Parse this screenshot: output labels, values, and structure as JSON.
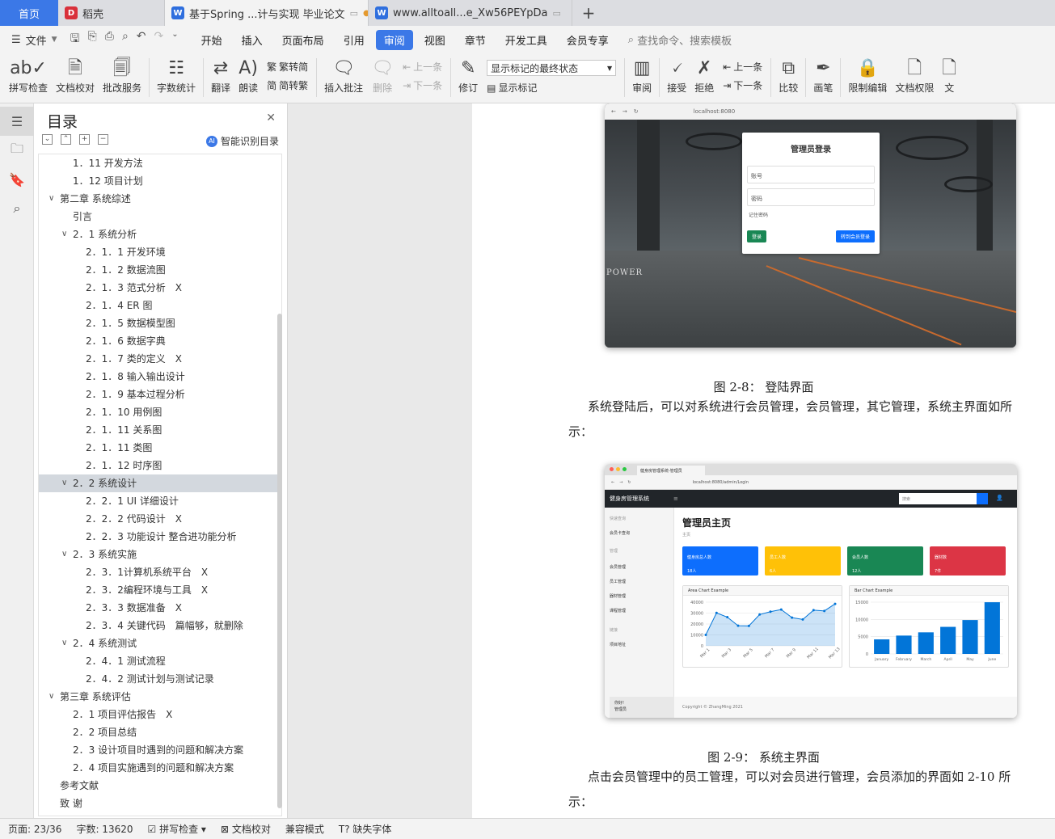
{
  "tabs": {
    "home": "首页",
    "items": [
      {
        "title": "稻壳",
        "icon_color": "#d9303a",
        "icon_glyph": "D"
      },
      {
        "title": "基于Spring ...计与实现 毕业论文",
        "icon_color": "#2f6fde",
        "icon_glyph": "W",
        "unsaved": true,
        "active": true
      },
      {
        "title": "www.alltoall...e_Xw56PEYpDa",
        "icon_color": "#2f6fde",
        "icon_glyph": "W"
      }
    ]
  },
  "menu": {
    "file": "文件",
    "items": [
      "开始",
      "插入",
      "页面布局",
      "引用",
      "审阅",
      "视图",
      "章节",
      "开发工具",
      "会员专享"
    ],
    "active": "审阅",
    "search": "查找命令、搜索模板"
  },
  "ribbon": {
    "spell_check": "拼写检查",
    "doc_proof": "文档校对",
    "annotate_service": "批改服务",
    "word_count": "字数统计",
    "translate": "翻译",
    "read_aloud": "朗读",
    "trad_to_simp": "繁转简",
    "simp_to_trad": "简转繁",
    "insert_comment": "插入批注",
    "delete": "删除",
    "prev_comment": "上一条",
    "next_comment": "下一条",
    "track_changes": "修订",
    "markup_state": "显示标记的最终状态",
    "show_markup": "显示标记",
    "review": "审阅",
    "accept": "接受",
    "reject": "拒绝",
    "prev_change": "上一条",
    "next_change": "下一条",
    "compare": "比较",
    "pen": "画笔",
    "restrict_edit": "限制编辑",
    "doc_permission": "文档权限",
    "doc_cut": "文"
  },
  "toc": {
    "title": "目录",
    "smart": "智能识别目录",
    "items": [
      {
        "text": "1．11 开发方法",
        "level": 3,
        "caret": ""
      },
      {
        "text": "1．12 项目计划",
        "level": 3,
        "caret": ""
      },
      {
        "text": "第二章 系统综述",
        "level": 1,
        "caret": "v"
      },
      {
        "text": "引言",
        "level": 3,
        "caret": ""
      },
      {
        "text": "2．1 系统分析",
        "level": 2,
        "caret": "v"
      },
      {
        "text": "2．1．1 开发环境",
        "level": 4,
        "caret": ""
      },
      {
        "text": "2．1．2 数据流图",
        "level": 4,
        "caret": ""
      },
      {
        "text": "2．1．3 范式分析　X",
        "level": 4,
        "caret": ""
      },
      {
        "text": "2．1．4 ER 图",
        "level": 4,
        "caret": ""
      },
      {
        "text": "2．1．5 数据模型图",
        "level": 4,
        "caret": ""
      },
      {
        "text": "2．1．6 数据字典",
        "level": 4,
        "caret": ""
      },
      {
        "text": "2．1．7 类的定义　X",
        "level": 4,
        "caret": ""
      },
      {
        "text": "2．1．8 输入输出设计",
        "level": 4,
        "caret": ""
      },
      {
        "text": "2．1．9 基本过程分析",
        "level": 4,
        "caret": ""
      },
      {
        "text": "2．1．10 用例图",
        "level": 4,
        "caret": ""
      },
      {
        "text": "2．1．11 关系图",
        "level": 4,
        "caret": ""
      },
      {
        "text": "2．1．11 类图",
        "level": 4,
        "caret": ""
      },
      {
        "text": "2．1．12 时序图",
        "level": 4,
        "caret": ""
      },
      {
        "text": "2．2 系统设计",
        "level": 2,
        "caret": "v",
        "selected": true
      },
      {
        "text": "2．2．1 UI 详细设计",
        "level": 4,
        "caret": ""
      },
      {
        "text": "2．2．2 代码设计　X",
        "level": 4,
        "caret": ""
      },
      {
        "text": "2．2．3 功能设计 整合进功能分析",
        "level": 4,
        "caret": ""
      },
      {
        "text": "2．3 系统实施",
        "level": 2,
        "caret": "v"
      },
      {
        "text": "2．3．1计算机系统平台　X",
        "level": 4,
        "caret": ""
      },
      {
        "text": "2．3．2编程环境与工具　X",
        "level": 4,
        "caret": ""
      },
      {
        "text": "2．3．3 数据准备　X",
        "level": 4,
        "caret": ""
      },
      {
        "text": "2．3．4 关键代码　篇幅够，就删除",
        "level": 4,
        "caret": ""
      },
      {
        "text": "2．4 系统测试",
        "level": 2,
        "caret": "v"
      },
      {
        "text": "2．4．1 测试流程",
        "level": 4,
        "caret": ""
      },
      {
        "text": "2．4．2 测试计划与测试记录",
        "level": 4,
        "caret": ""
      },
      {
        "text": "第三章 系统评估",
        "level": 1,
        "caret": "v"
      },
      {
        "text": "2．1 项目评估报告　X",
        "level": 3,
        "caret": ""
      },
      {
        "text": "2．2 项目总结",
        "level": 3,
        "caret": ""
      },
      {
        "text": "2．3 设计项目时遇到的问题和解决方案",
        "level": 3,
        "caret": ""
      },
      {
        "text": "2．4 项目实施遇到的问题和解决方案",
        "level": 3,
        "caret": ""
      },
      {
        "text": "参考文献",
        "level": 1,
        "caret": ""
      },
      {
        "text": "致 谢",
        "level": 1,
        "caret": ""
      }
    ]
  },
  "document": {
    "login_shot": {
      "url": "localhost:8080",
      "title": "管理员登录",
      "account": "账号",
      "password": "密码",
      "remember": "记住密码",
      "login": "登录",
      "member_login": "转到会员登录",
      "sign": "POWER"
    },
    "caption1": "图 2-8：  登陆界面",
    "para1": "系统登陆后，可以对系统进行会员管理，会员管理，其它管理，系统主界面如所示：",
    "admin_shot": {
      "tab": "健身房管理系统-管理员",
      "url": "localhost:8080/admin/Login",
      "brand": "健身房管理系统",
      "search": "搜索",
      "sidebar": {
        "group1": "快速查询",
        "card_query": "会员卡查询",
        "group2": "管理",
        "member_mgmt": "会员管理",
        "staff_mgmt": "员工管理",
        "equip_mgmt": "器材管理",
        "course_mgmt": "课程管理",
        "group3": "链接",
        "project_addr": "项目地址",
        "hello": "你好!",
        "role": "管理员"
      },
      "heading": "管理员主页",
      "crumb": "主页",
      "cards": [
        {
          "title": "健身房总人数",
          "value": "18人",
          "color": "#0d6efd"
        },
        {
          "title": "员工人数",
          "value": "6人",
          "color": "#ffc107"
        },
        {
          "title": "会员人数",
          "value": "12人",
          "color": "#198754"
        },
        {
          "title": "器材数",
          "value": "7件",
          "color": "#dc3545"
        }
      ],
      "area_title": "Area Chart Example",
      "bar_title": "Bar Chart Example",
      "footer": "Copyright © ZhangMing 2021"
    },
    "caption2": "图 2-9：  系统主界面",
    "para2": "点击会员管理中的员工管理，可以对会员进行管理，会员添加的界面如 2-10 所示："
  },
  "chart_data": [
    {
      "type": "area",
      "title": "Area Chart Example",
      "x": [
        "Mar 1",
        "Mar 2",
        "Mar 3",
        "Mar 4",
        "Mar 5",
        "Mar 6",
        "Mar 7",
        "Mar 8",
        "Mar 9",
        "Mar 10",
        "Mar 11",
        "Mar 12",
        "Mar 13"
      ],
      "x_tick_labels": [
        "Mar 1",
        "Mar 3",
        "Mar 5",
        "Mar 7",
        "Mar 9",
        "Mar 11",
        "Mar 13"
      ],
      "values": [
        10000,
        30162,
        26263,
        18394,
        18287,
        28682,
        31274,
        33259,
        25849,
        24159,
        32651,
        31984,
        38451
      ],
      "ylim": [
        0,
        40000
      ],
      "yticks": [
        0,
        10000,
        20000,
        30000,
        40000
      ],
      "color": "#0275d8"
    },
    {
      "type": "bar",
      "title": "Bar Chart Example",
      "categories": [
        "January",
        "February",
        "March",
        "April",
        "May",
        "June"
      ],
      "values": [
        4215,
        5312,
        6251,
        7841,
        9821,
        14984
      ],
      "ylim": [
        0,
        15000
      ],
      "yticks": [
        0,
        5000,
        10000,
        15000
      ],
      "color": "#0275d8"
    }
  ],
  "statusbar": {
    "page": "页面: 23/36",
    "words": "字数: 13620",
    "spell": "拼写检查",
    "proof": "文档校对",
    "compat": "兼容模式",
    "missing_font": "缺失字体"
  }
}
